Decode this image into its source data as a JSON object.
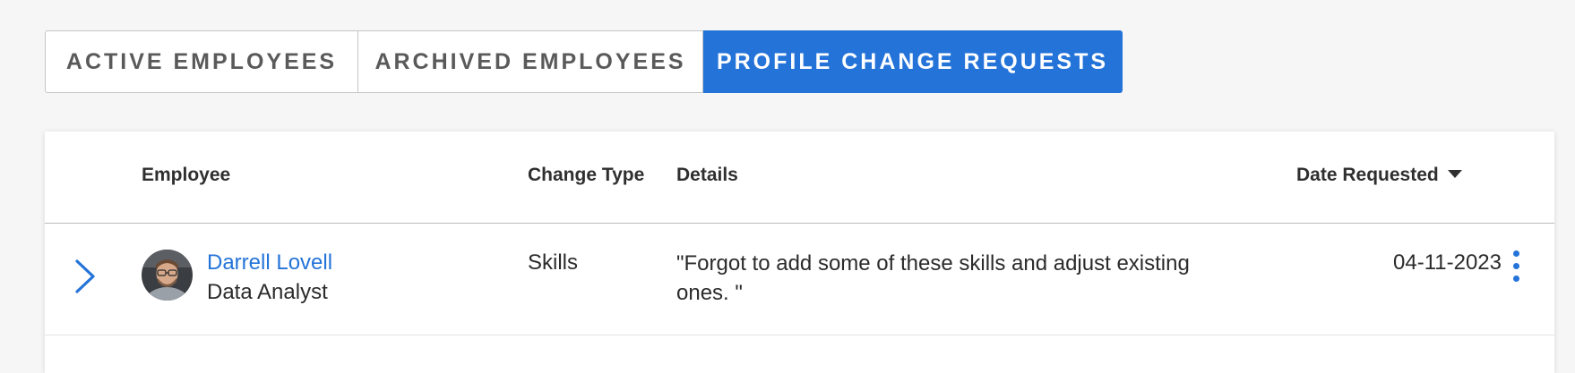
{
  "tabs": [
    {
      "label": "ACTIVE EMPLOYEES",
      "active": false
    },
    {
      "label": "ARCHIVED EMPLOYEES",
      "active": false
    },
    {
      "label": "PROFILE CHANGE REQUESTS",
      "active": true
    }
  ],
  "table": {
    "columns": {
      "employee": "Employee",
      "change_type": "Change Type",
      "details": "Details",
      "date_requested": "Date Requested"
    },
    "sort": {
      "column": "date_requested",
      "direction": "descending",
      "icon": "caret-down-icon"
    },
    "rows": [
      {
        "name": "Darrell Lovell",
        "title": "Data Analyst",
        "change_type": "Skills",
        "details": "\"Forgot to add some of these skills and adjust existing ones. \"",
        "date": "04-11-2023"
      }
    ]
  },
  "colors": {
    "accent": "#2473d9",
    "background": "#f6f6f6",
    "card": "#ffffff",
    "tab_text": "#5a5a5a"
  }
}
